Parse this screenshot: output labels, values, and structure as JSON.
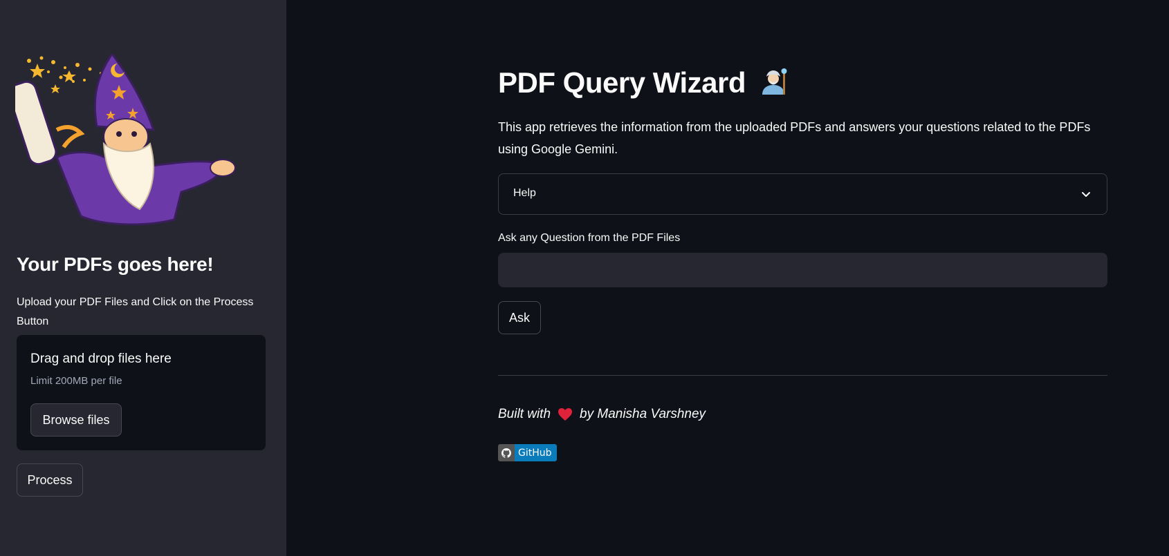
{
  "sidebar": {
    "logo_icon": "wizard-mascot-icon",
    "title": "Your PDFs goes here!",
    "description": "Upload your PDF Files and Click on the Process Button",
    "uploader": {
      "title": "Drag and drop files here",
      "limit": "Limit 200MB per file",
      "browse_label": "Browse files"
    },
    "process_label": "Process"
  },
  "main": {
    "title": "PDF Query Wizard",
    "title_icon": "mage-emoji-icon",
    "description": "This app retrieves the information from the uploaded PDFs and answers your questions related to the PDFs using Google Gemini.",
    "expander_label": "Help",
    "question_label": "Ask any Question from the PDF Files",
    "question_value": "",
    "ask_label": "Ask",
    "footer": {
      "prefix": "Built with",
      "heart_icon": "red-heart-icon",
      "suffix": "by Manisha Varshney"
    },
    "badge": {
      "icon": "github-icon",
      "label": "GitHub"
    }
  },
  "colors": {
    "sidebar_bg": "#262730",
    "main_bg": "#0e1117",
    "input_bg": "#262730",
    "badge_blue": "#0a7bbb",
    "badge_gray": "#555555"
  }
}
